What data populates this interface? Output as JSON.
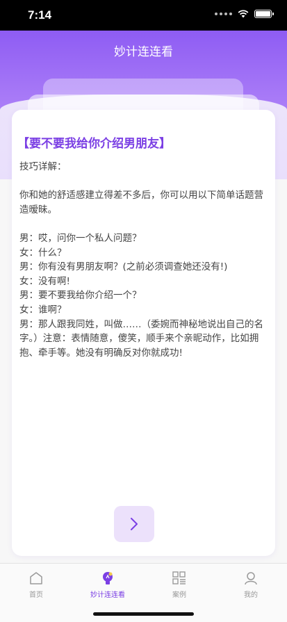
{
  "status_bar": {
    "time": "7:14"
  },
  "header": {
    "title": "妙计连连看"
  },
  "card": {
    "title": "【要不要我给你介绍男朋友】",
    "paragraphs": [
      "技巧详解：",
      "",
      "你和她的舒适感建立得差不多后，你可以用以下简单话题营造暧昧。",
      "",
      "男：哎，问你一个私人问题？",
      "女：什么？",
      "男：你有没有男朋友啊？(之前必须调查她还没有!)",
      "女：没有啊!",
      "男：要不要我给你介绍一个？",
      "女：谁啊？",
      "男：那人跟我同姓，叫做……（委婉而神秘地说出自己的名字。）注意：表情随意，傻笑，顺手来个亲昵动作，比如拥抱、牵手等。她没有明确反对你就成功!"
    ]
  },
  "next_button": {
    "icon": "chevron-right-icon"
  },
  "tabbar": {
    "tabs": [
      {
        "label": "首页",
        "icon": "home-icon",
        "active": false
      },
      {
        "label": "妙计连连看",
        "icon": "lightbulb-icon",
        "active": true
      },
      {
        "label": "案例",
        "icon": "grid-list-icon",
        "active": false
      },
      {
        "label": "我的",
        "icon": "user-icon",
        "active": false
      }
    ]
  },
  "colors": {
    "accent": "#7b3fe4",
    "header_top": "#8e5cf3",
    "header_bottom": "#b68af9"
  }
}
